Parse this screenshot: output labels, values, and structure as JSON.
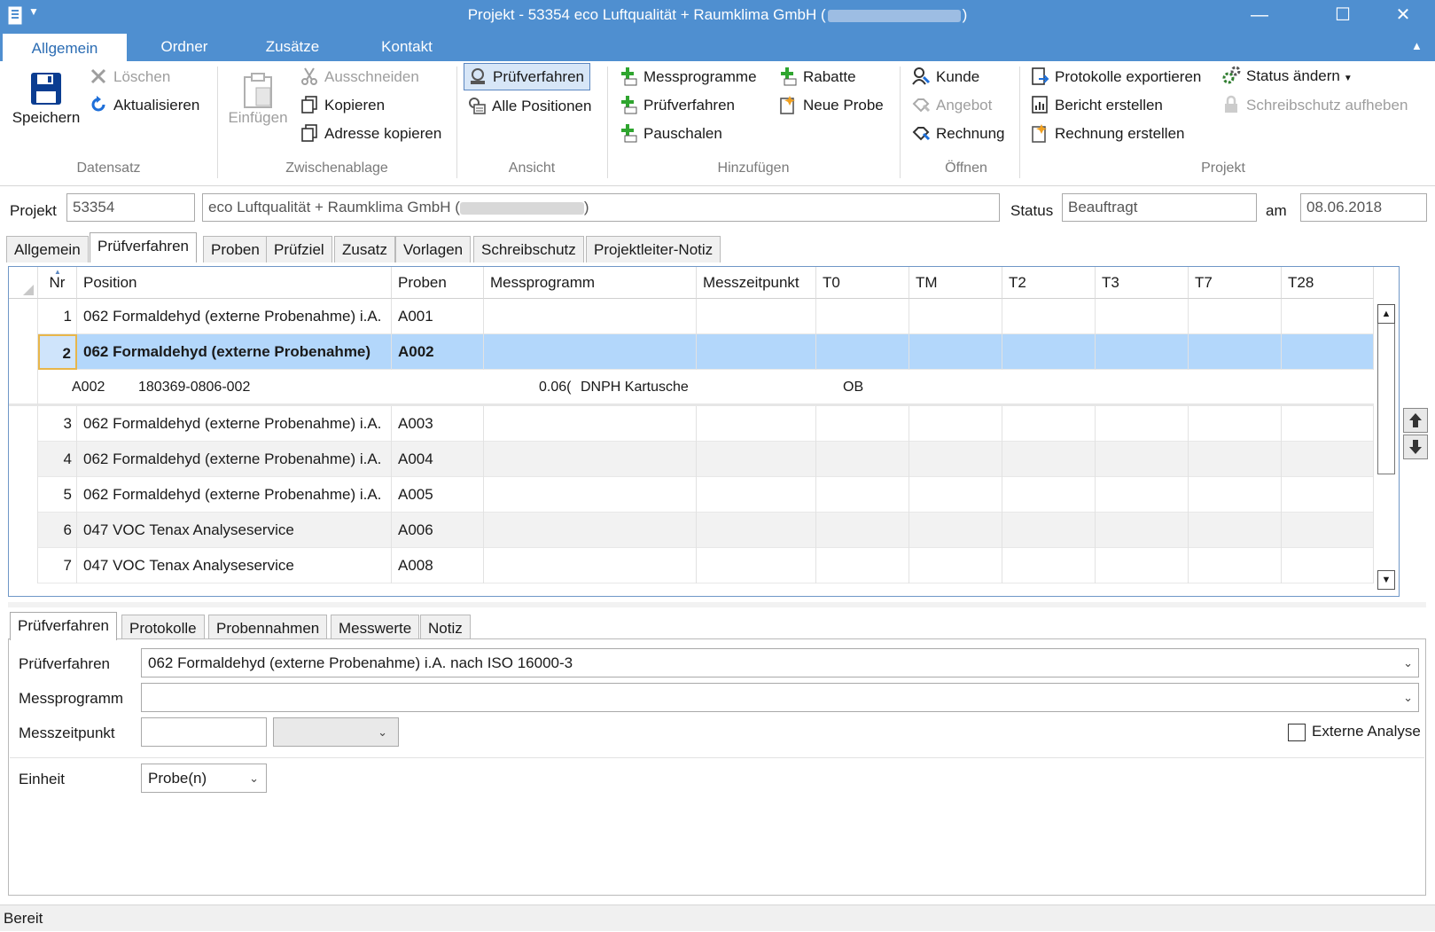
{
  "window": {
    "title_prefix": "Projekt - 53354 eco Luftqualität + Raumklima GmbH (",
    "title_suffix": ")"
  },
  "ribbon_tabs": [
    "Allgemein",
    "Ordner",
    "Zusätze",
    "Kontakt"
  ],
  "ribbon": {
    "datensatz": {
      "label": "Datensatz",
      "save": "Speichern",
      "delete": "Löschen",
      "refresh": "Aktualisieren"
    },
    "zwischenablage": {
      "label": "Zwischenablage",
      "paste": "Einfügen",
      "cut": "Ausschneiden",
      "copy": "Kopieren",
      "copy_address": "Adresse kopieren"
    },
    "ansicht": {
      "label": "Ansicht",
      "pruefverfahren": "Prüfverfahren",
      "all_positions": "Alle Positionen"
    },
    "hinzufuegen": {
      "label": "Hinzufügen",
      "messprogramme": "Messprogramme",
      "pruefverfahren": "Prüfverfahren",
      "pauschalen": "Pauschalen",
      "rabatte": "Rabatte",
      "neue_probe": "Neue Probe"
    },
    "oeffnen": {
      "label": "Öffnen",
      "kunde": "Kunde",
      "angebot": "Angebot",
      "rechnung": "Rechnung"
    },
    "projekt": {
      "label": "Projekt",
      "export": "Protokolle exportieren",
      "report": "Bericht erstellen",
      "invoice": "Rechnung erstellen",
      "status": "Status ändern",
      "unlock": "Schreibschutz aufheben"
    }
  },
  "project": {
    "label": "Projekt",
    "number": "53354",
    "name_prefix": "eco Luftqualität + Raumklima GmbH (",
    "name_suffix": ")",
    "status_label": "Status",
    "status": "Beauftragt",
    "date_label": "am",
    "date": "08.06.2018"
  },
  "tabs": [
    "Allgemein",
    "Prüfverfahren",
    "Proben",
    "Prüfziel",
    "Zusatz",
    "Vorlagen",
    "Schreibschutz",
    "Projektleiter-Notiz"
  ],
  "grid": {
    "columns": [
      "Nr",
      "Position",
      "Proben",
      "Messprogramm",
      "Messzeitpunkt",
      "T0",
      "TM",
      "T2",
      "T3",
      "T7",
      "T28"
    ],
    "rows": [
      {
        "nr": "1",
        "position": "062 Formaldehyd (externe Probenahme) i.A.",
        "proben": "A001"
      },
      {
        "nr": "2",
        "position": "062 Formaldehyd (externe Probenahme)",
        "proben": "A002"
      },
      {
        "nr": "3",
        "position": "062 Formaldehyd (externe Probenahme) i.A.",
        "proben": "A003"
      },
      {
        "nr": "4",
        "position": "062 Formaldehyd (externe Probenahme) i.A.",
        "proben": "A004"
      },
      {
        "nr": "5",
        "position": "062 Formaldehyd (externe Probenahme) i.A.",
        "proben": "A005"
      },
      {
        "nr": "6",
        "position": "047 VOC Tenax Analyseservice",
        "proben": "A006"
      },
      {
        "nr": "7",
        "position": "047 VOC Tenax Analyseservice",
        "proben": "A008"
      }
    ],
    "detail": {
      "probe": "A002",
      "code": "180369-0806-002",
      "value": "0.06(",
      "medium": "DNPH Kartusche",
      "t0": "OB"
    }
  },
  "bottom_tabs": [
    "Prüfverfahren",
    "Protokolle",
    "Probennahmen",
    "Messwerte",
    "Notiz"
  ],
  "form": {
    "pruefverfahren_label": "Prüfverfahren",
    "pruefverfahren_value": "062 Formaldehyd (externe Probenahme) i.A. nach ISO 16000-3",
    "messprogramm_label": "Messprogramm",
    "messprogramm_value": "",
    "messzeitpunkt_label": "Messzeitpunkt",
    "messzeitpunkt_value": "",
    "externe_analyse_label": "Externe Analyse",
    "einheit_label": "Einheit",
    "einheit_value": "Probe(n)"
  },
  "statusbar": {
    "text": "Bereit"
  }
}
